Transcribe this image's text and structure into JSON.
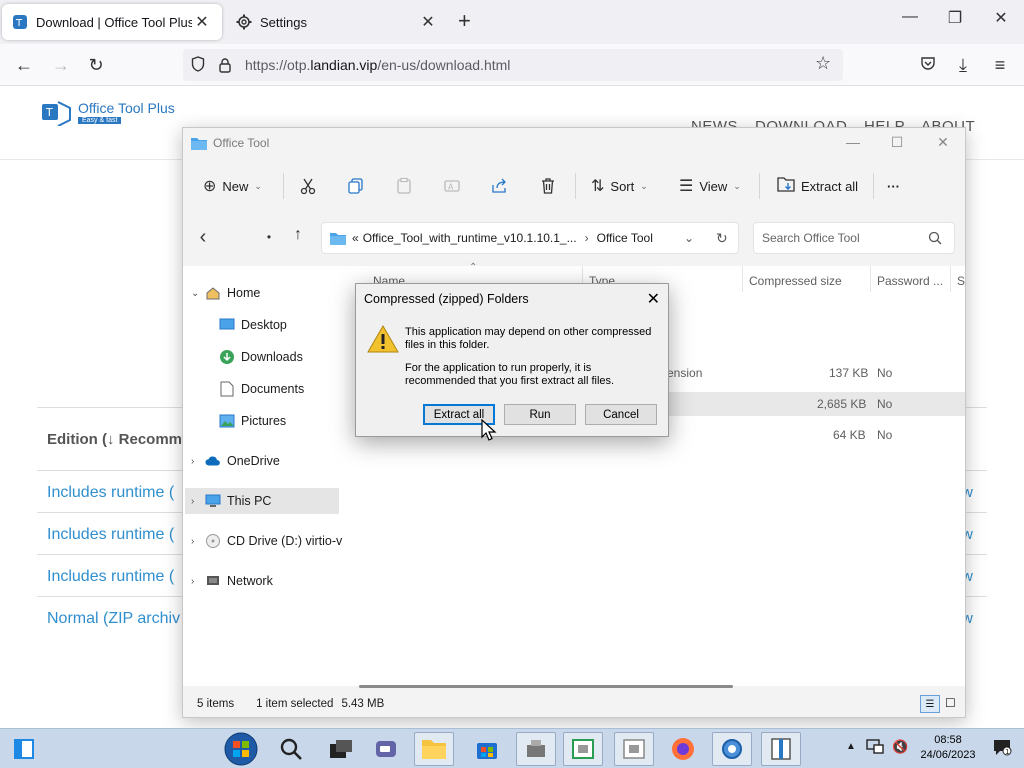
{
  "browser": {
    "tabs": [
      {
        "title": "Download | Office Tool Plus We",
        "close": "✕"
      },
      {
        "title": "Settings",
        "close": "✕"
      }
    ],
    "new_tab": "+",
    "url_prefix": "https://otp.",
    "url_domain": "landian.vip",
    "url_path": "/en-us/download.html"
  },
  "site": {
    "logo_name": "Office Tool Plus",
    "logo_tag": "Easy & fast",
    "nav": [
      "NEWS",
      "DOWNLOAD",
      "HELP",
      "ABOUT"
    ],
    "edition_header": "Edition (↓ Recomm",
    "links": [
      "Includes runtime (",
      "Includes runtime (",
      "Includes runtime (",
      "Normal (ZIP archiv"
    ],
    "link_right": "w"
  },
  "explorer": {
    "title": "Office Tool",
    "commands": {
      "new": "New",
      "sort": "Sort",
      "view": "View",
      "extract_all": "Extract all",
      "more": "···"
    },
    "address": {
      "prefix": "«",
      "segment1": "Office_Tool_with_runtime_v10.1.10.1_...",
      "sep": "›",
      "segment2": "Office Tool"
    },
    "search_placeholder": "Search Office Tool",
    "nav": {
      "home": "Home",
      "desktop": "Desktop",
      "downloads": "Downloads",
      "documents": "Documents",
      "pictures": "Pictures",
      "onedrive": "OneDrive",
      "this_pc": "This PC",
      "cd_drive": "CD Drive (D:) virtio-v",
      "network": "Network"
    },
    "columns": [
      "Name",
      "Type",
      "Compressed size",
      "Password ...",
      "Si"
    ],
    "rows": [
      {
        "type": "ension",
        "size": "137 KB",
        "password": "No"
      },
      {
        "type": "",
        "size": "2,685 KB",
        "password": "No"
      },
      {
        "type": "",
        "size": "64 KB",
        "password": "No"
      }
    ],
    "status": {
      "items": "5 items",
      "selected": "1 item selected",
      "size": "5.43 MB"
    }
  },
  "dialog": {
    "title": "Compressed (zipped) Folders",
    "message1": "This application may depend on other compressed files in this folder.",
    "message2": "For the application to run properly, it is recommended that you first extract all files.",
    "buttons": {
      "extract_all": "Extract all",
      "run": "Run",
      "cancel": "Cancel"
    }
  },
  "taskbar": {
    "time": "08:58",
    "date": "24/06/2023"
  },
  "colors": {
    "accent": "#0078d7",
    "link": "#2f8fcf",
    "taskbar": "#c8d8ea",
    "warning": "#f2c12e"
  }
}
